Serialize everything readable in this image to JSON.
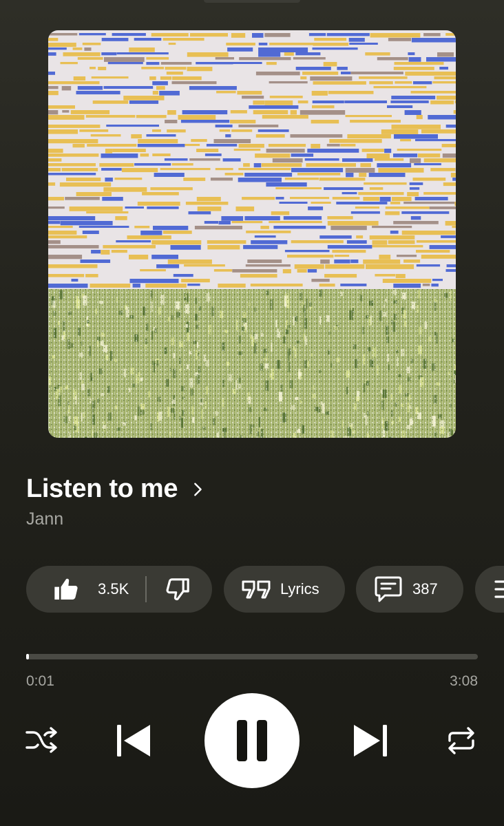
{
  "track": {
    "title": "Listen to me",
    "artist": "Jann"
  },
  "actions": {
    "likes": "3.5K",
    "lyrics_label": "Lyrics",
    "comments": "387"
  },
  "playback": {
    "current_time": "0:01",
    "total_time": "3:08",
    "progress_fraction": 0.005,
    "state": "playing"
  },
  "icons": [
    "chevron-right-icon",
    "thumbs-up-icon",
    "thumbs-down-icon",
    "quote-icon",
    "comment-icon",
    "menu-icon",
    "shuffle-icon",
    "previous-icon",
    "pause-icon",
    "next-icon",
    "repeat-icon"
  ],
  "colors": {
    "background": "#26261f",
    "pill": "#3a3a34",
    "secondary_text": "#a7a7a2",
    "art_yellow": "#e8b83a",
    "art_blue": "#2a4bd0",
    "art_green": "#9aa85a"
  }
}
